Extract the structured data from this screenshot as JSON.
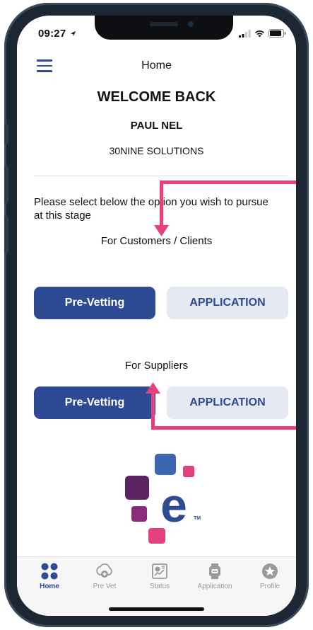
{
  "status_bar": {
    "time": "09:27"
  },
  "header": {
    "title": "Home"
  },
  "welcome": {
    "heading": "WELCOME BACK",
    "user_name": "PAUL NEL",
    "company": "30NINE SOLUTIONS"
  },
  "instruction": "Please select below the option you wish to pursue at this stage",
  "customers": {
    "label": "For Customers / Clients",
    "prevet_label": "Pre-Vetting",
    "application_label": "APPLICATION"
  },
  "suppliers": {
    "label": "For Suppliers",
    "prevet_label": "Pre-Vetting",
    "application_label": "APPLICATION"
  },
  "logo": {
    "tm": "TM"
  },
  "tabbar": {
    "items": [
      {
        "label": "Home",
        "icon": "home-grid-icon",
        "active": true
      },
      {
        "label": "Pre Vet",
        "icon": "pre-vet-icon"
      },
      {
        "label": "Status",
        "icon": "status-icon"
      },
      {
        "label": "Application",
        "icon": "application-icon"
      },
      {
        "label": "Profile",
        "icon": "profile-star-icon"
      }
    ]
  },
  "colors": {
    "primary": "#2e4a93",
    "secondary_bg": "#e5e9f1",
    "annotation": "#e8407f"
  }
}
